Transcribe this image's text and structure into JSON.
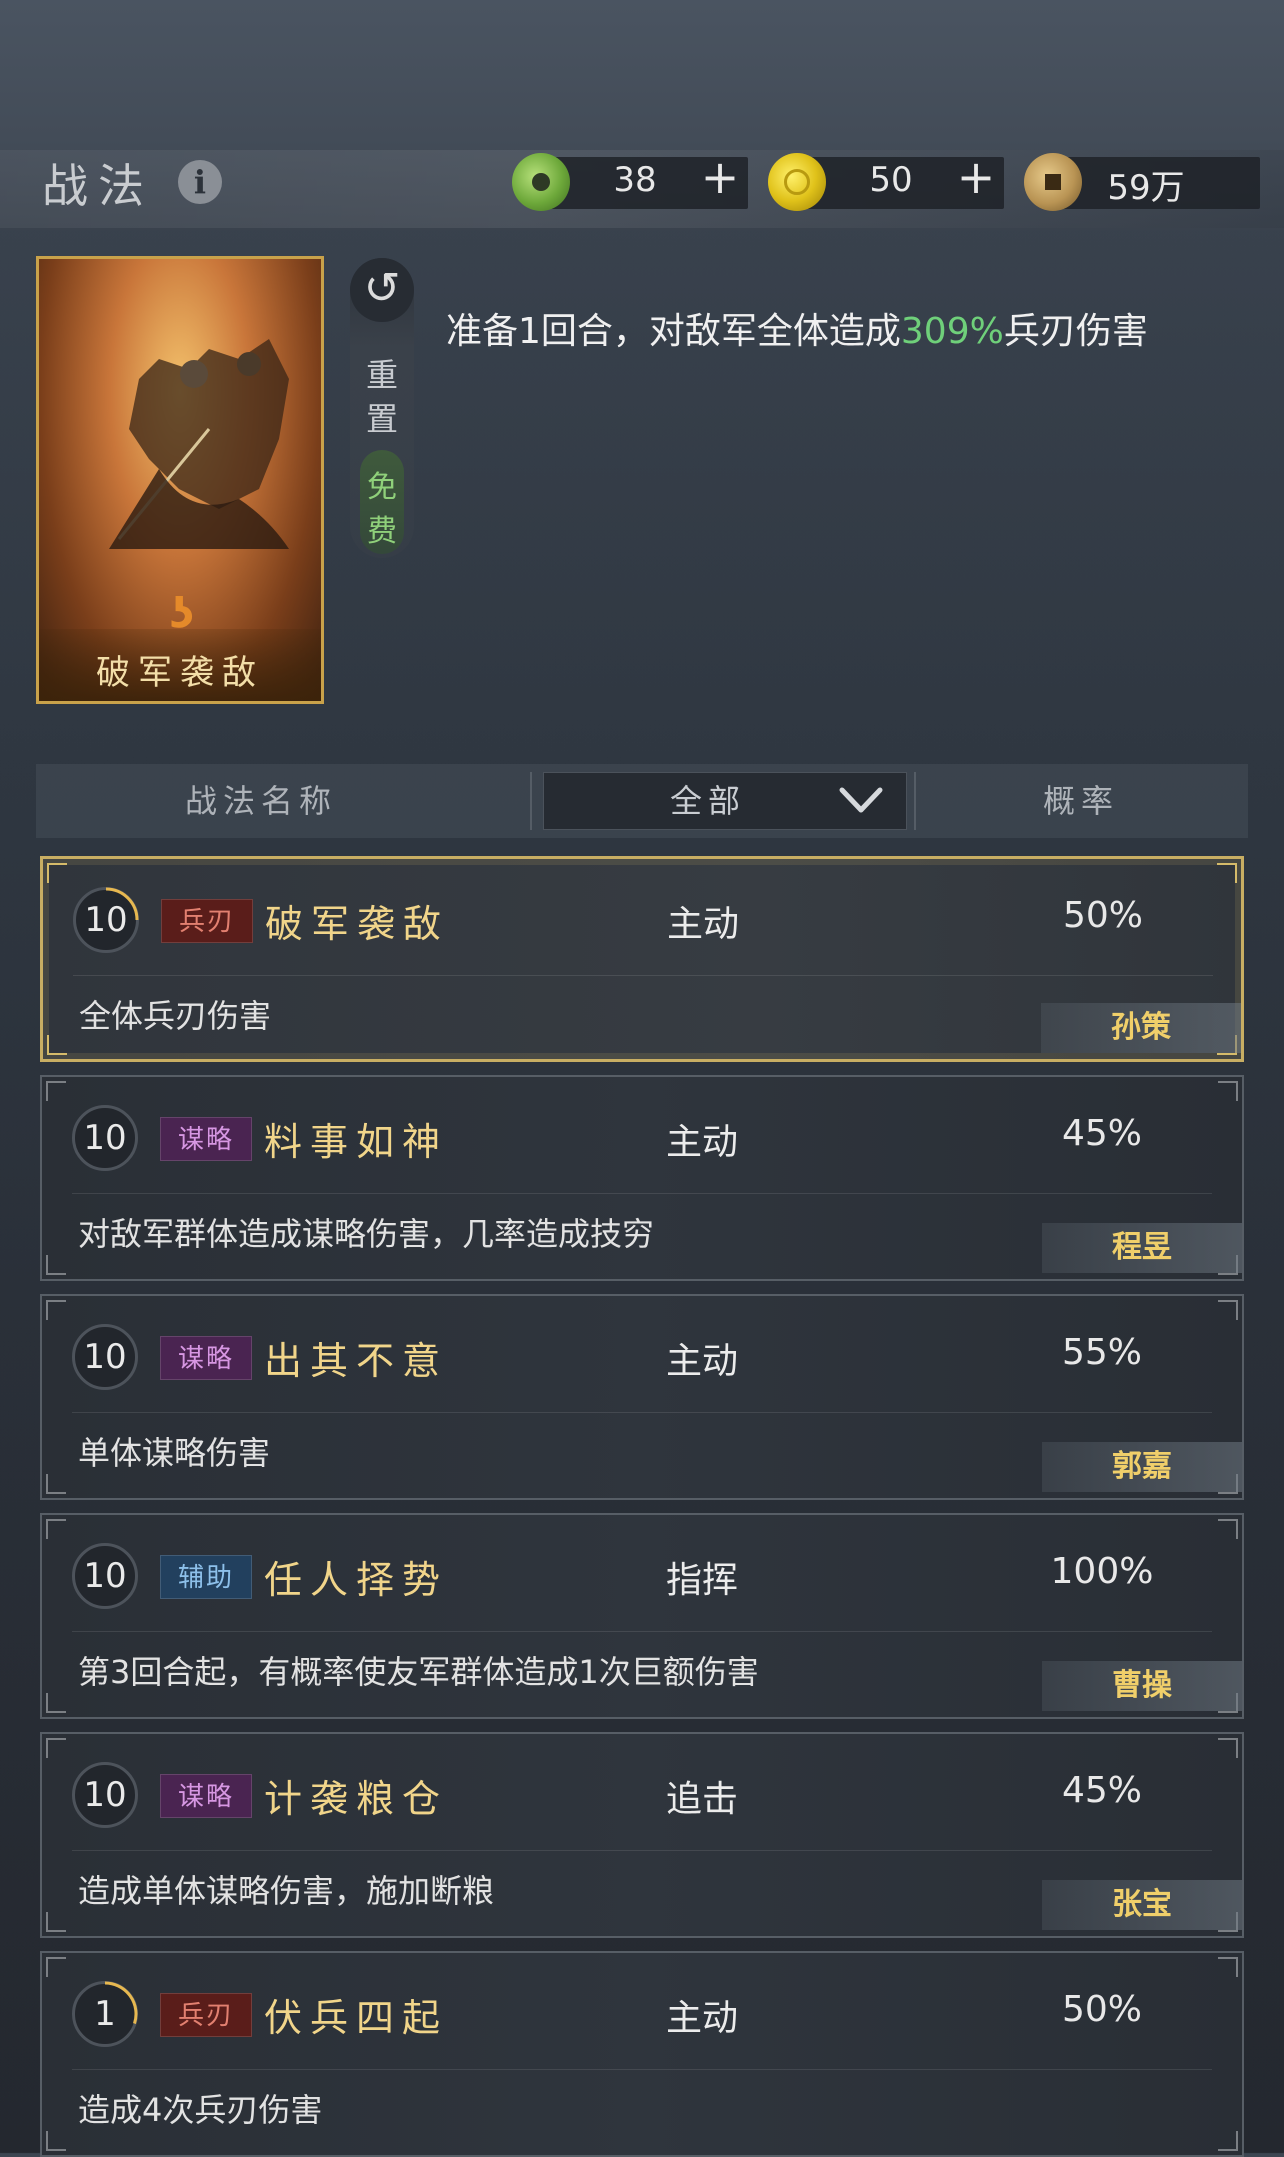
{
  "header": {
    "title": "战法",
    "info_icon": "info-icon",
    "resources": [
      {
        "icon": "jade-icon",
        "value": "38",
        "plus": "+"
      },
      {
        "icon": "gold-icon",
        "value": "50",
        "plus": "+"
      },
      {
        "icon": "copper-coin-icon",
        "value": "59万"
      }
    ]
  },
  "featured": {
    "card_name": "破军袭敌",
    "emblem": "ʖ",
    "reset_label_1": "重",
    "reset_label_2": "置",
    "free_label_1": "免",
    "free_label_2": "费",
    "description_prefix": "准备1回合，对敌军全体造成",
    "description_highlight": "309%",
    "description_suffix": "兵刃伤害",
    "highlight_color": "#6fd07a"
  },
  "table_header": {
    "name": "战法名称",
    "filter": "全部",
    "rate": "概率"
  },
  "skills": [
    {
      "level": "10",
      "level_fraction": 0.25,
      "tag": "兵刃",
      "tag_kind": "blade",
      "name": "破军袭敌",
      "type": "主动",
      "rate": "50%",
      "desc": "全体兵刃伤害",
      "owner": "孙策",
      "selected": true
    },
    {
      "level": "10",
      "level_fraction": 0,
      "tag": "谋略",
      "tag_kind": "strat",
      "name": "料事如神",
      "type": "主动",
      "rate": "45%",
      "desc": "对敌军群体造成谋略伤害，几率造成技穷",
      "owner": "程昱",
      "selected": false
    },
    {
      "level": "10",
      "level_fraction": 0,
      "tag": "谋略",
      "tag_kind": "strat",
      "name": "出其不意",
      "type": "主动",
      "rate": "55%",
      "desc": "单体谋略伤害",
      "owner": "郭嘉",
      "selected": false
    },
    {
      "level": "10",
      "level_fraction": 0,
      "tag": "辅助",
      "tag_kind": "assist",
      "name": "任人择势",
      "type": "指挥",
      "rate": "100%",
      "desc": "第3回合起，有概率使友军群体造成1次巨额伤害",
      "owner": "曹操",
      "selected": false
    },
    {
      "level": "10",
      "level_fraction": 0,
      "tag": "谋略",
      "tag_kind": "strat",
      "name": "计袭粮仓",
      "type": "追击",
      "rate": "45%",
      "desc": "造成单体谋略伤害，施加断粮",
      "owner": "张宝",
      "selected": false
    },
    {
      "level": "1",
      "level_fraction": 0.3,
      "tag": "兵刃",
      "tag_kind": "blade",
      "name": "伏兵四起",
      "type": "主动",
      "rate": "50%",
      "desc": "造成4次兵刃伤害",
      "owner": "",
      "selected": false
    }
  ]
}
